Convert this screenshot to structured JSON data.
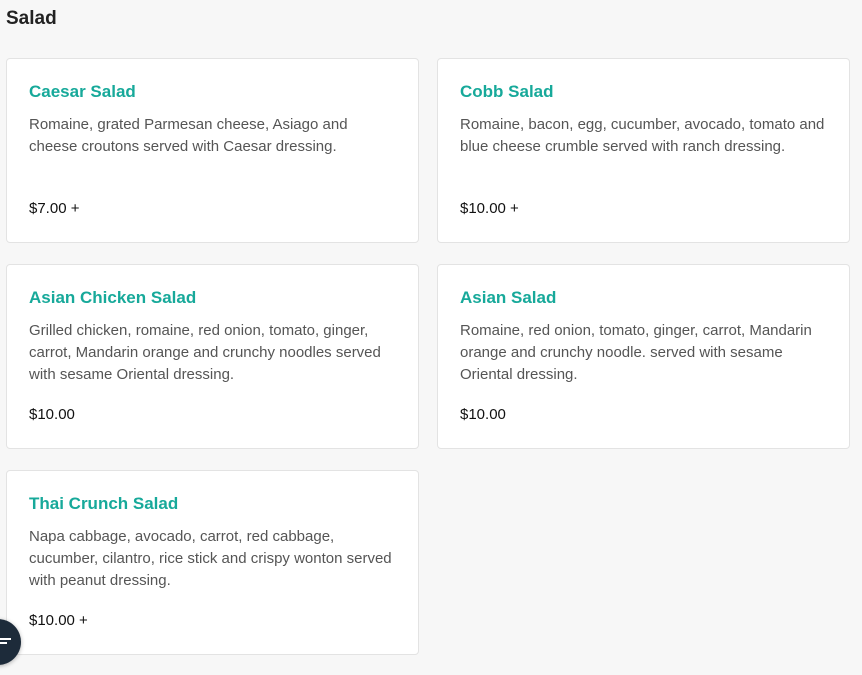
{
  "section": {
    "title": "Salad"
  },
  "items": [
    {
      "name": "Caesar Salad",
      "description": "Romaine, grated Parmesan cheese, Asiago and cheese croutons served with Caesar dressing.",
      "price": "$7.00 +"
    },
    {
      "name": "Cobb Salad",
      "description": "Romaine, bacon, egg, cucumber, avocado, tomato and blue cheese crumble served with ranch dressing.",
      "price": "$10.00 +"
    },
    {
      "name": "Asian Chicken Salad",
      "description": "Grilled chicken, romaine, red onion, tomato, ginger, carrot, Mandarin orange and crunchy noodles served with sesame Oriental dressing.",
      "price": "$10.00"
    },
    {
      "name": "Asian Salad",
      "description": "Romaine, red onion, tomato, ginger, carrot, Mandarin orange and crunchy noodle. served with sesame Oriental dressing.",
      "price": "$10.00"
    },
    {
      "name": "Thai Crunch Salad",
      "description": "Napa cabbage, avocado, carrot, red cabbage, cucumber, cilantro, rice stick and crispy wonton served with peanut dressing.",
      "price": "$10.00 +"
    }
  ],
  "fab": {
    "icon": "filter-icon"
  },
  "colors": {
    "accent": "#17a99a",
    "fab": "#1d2b3a",
    "background": "#f7f7f7"
  }
}
